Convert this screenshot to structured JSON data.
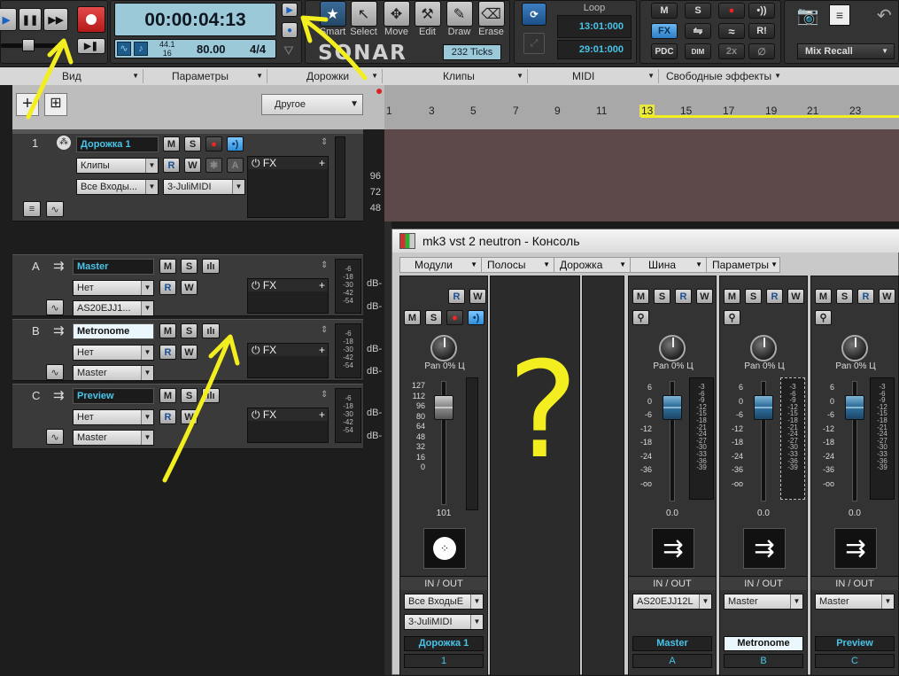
{
  "colors": {
    "accent": "#49c4e8",
    "highlight": "#f3ee1f",
    "record": "#e02626",
    "clip_bg": "#5c4749"
  },
  "transport": {
    "time": "00:00:04:13",
    "sample_rate": "44.1",
    "bit_depth": "16",
    "tempo": "80.00",
    "meter": "4/4"
  },
  "tools": [
    {
      "label": "Smart",
      "icon": "star-icon"
    },
    {
      "label": "Select",
      "icon": "cursor-icon"
    },
    {
      "label": "Move",
      "icon": "move-icon"
    },
    {
      "label": "Edit",
      "icon": "wrench-icon"
    },
    {
      "label": "Draw",
      "icon": "pencil-icon"
    },
    {
      "label": "Erase",
      "icon": "eraser-icon"
    }
  ],
  "snap": {
    "value": "232 Ticks"
  },
  "logo": "SONAR",
  "loop": {
    "label": "Loop",
    "start": "13:01:000",
    "end": "29:01:000"
  },
  "control": {
    "m": "M",
    "s": "S",
    "fx": "FX",
    "r": "R!",
    "pdc": "PDC",
    "dim": "DIM",
    "x2": "2x",
    "mix_recall": "Mix Recall"
  },
  "menu": [
    "Вид",
    "Параметры",
    "Дорожки",
    "Клипы",
    "MIDI",
    "Свободные эффекты"
  ],
  "toolbar": {
    "preset": "Другое"
  },
  "ruler": [
    "1",
    "3",
    "5",
    "7",
    "9",
    "11",
    "13",
    "15",
    "17",
    "19",
    "21",
    "23"
  ],
  "velocity_scale": [
    "96",
    "72",
    "48"
  ],
  "tracks": [
    {
      "num": "1",
      "name": "Дорожка 1",
      "clips": "Клипы",
      "input": "Все Входы...",
      "output": "3-JuliMIDI",
      "fx": "FX"
    },
    {
      "num": "A",
      "name": "Master",
      "input": "Нет",
      "output": "AS20EJJ1...",
      "fx": "FX"
    },
    {
      "num": "B",
      "name": "Metronome",
      "input": "Нет",
      "output": "Master",
      "fx": "FX"
    },
    {
      "num": "C",
      "name": "Preview",
      "input": "Нет",
      "output": "Master",
      "fx": "FX"
    }
  ],
  "db_label": "dB-",
  "meter_ticks": [
    "-6",
    "-18",
    "-30",
    "-42",
    "-54"
  ],
  "btn": {
    "m": "M",
    "s": "S",
    "r": "R",
    "w": "W",
    "a": "A"
  },
  "console": {
    "title": "mk3 vst 2 neutron - Консоль",
    "menu": [
      "Модули",
      "Полосы",
      "Дорожка",
      "Шина",
      "Параметры"
    ],
    "pan_label": "Pan",
    "pan_value": "0% Ц",
    "midi_scale": [
      "127",
      "112",
      "96",
      "80",
      "64",
      "48",
      "32",
      "16",
      "0"
    ],
    "midi_value": "101",
    "audio_scale": [
      "6",
      "0",
      "-6",
      "-12",
      "-18",
      "-24",
      "-36",
      "-oo"
    ],
    "meter_scale": [
      "-3",
      "-6",
      "-9",
      "-12",
      "-15",
      "-18",
      "-21",
      "-24",
      "-27",
      "-30",
      "-33",
      "-36",
      "-39"
    ],
    "io_label": "IN / OUT",
    "strips": [
      {
        "name": "Дорожка 1",
        "id": "1",
        "in": "Все ВходыE",
        "out": "3-JuliMIDI"
      },
      {
        "name": "Master",
        "id": "A",
        "out": "AS20EJJ12L",
        "value": "0.0"
      },
      {
        "name": "Metronome",
        "id": "B",
        "out": "Master",
        "value": "0.0"
      },
      {
        "name": "Preview",
        "id": "C",
        "out": "Master",
        "value": "0.0"
      }
    ]
  },
  "annotation": {
    "question": "?"
  }
}
